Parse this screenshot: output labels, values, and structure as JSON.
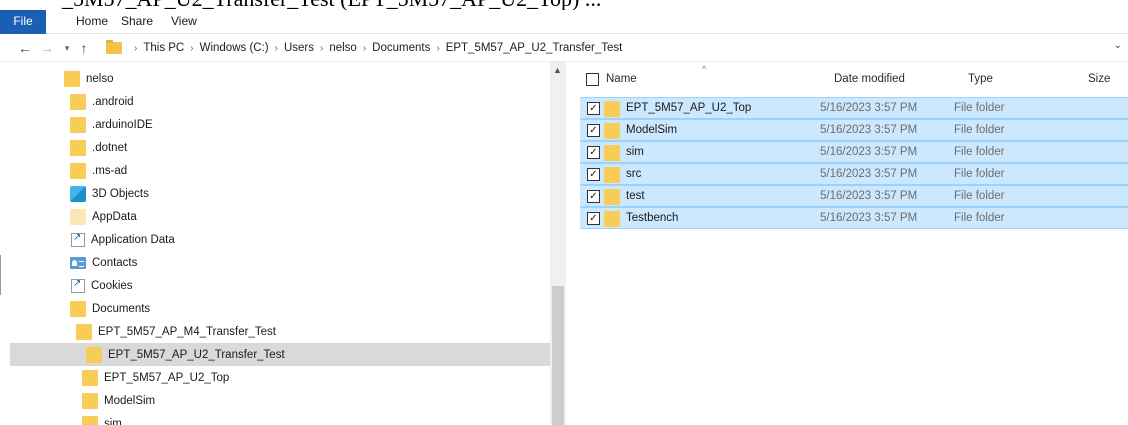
{
  "clipped_title": "_5M57_AP_U2_Transfer_Test (EPT_5M57_AP_U2_Top) ...",
  "ribbon": {
    "tabs": [
      "File",
      "Home",
      "Share",
      "View"
    ]
  },
  "address": {
    "breadcrumbs": [
      "This PC",
      "Windows (C:)",
      "Users",
      "nelso",
      "Documents",
      "EPT_5M57_AP_U2_Transfer_Test"
    ]
  },
  "nav": {
    "items": [
      {
        "label": "nelso",
        "icon": "folder-icon"
      },
      {
        "label": ".android",
        "icon": "folder-icon"
      },
      {
        "label": ".arduinoIDE",
        "icon": "folder-icon"
      },
      {
        "label": ".dotnet",
        "icon": "folder-icon"
      },
      {
        "label": ".ms-ad",
        "icon": "folder-icon"
      },
      {
        "label": "3D Objects",
        "icon": "3d-objects-icon"
      },
      {
        "label": "AppData",
        "icon": "folder-icon"
      },
      {
        "label": "Application Data",
        "icon": "shortcut-icon"
      },
      {
        "label": "Contacts",
        "icon": "contacts-icon"
      },
      {
        "label": "Cookies",
        "icon": "shortcut-icon"
      },
      {
        "label": "Documents",
        "icon": "folder-icon"
      },
      {
        "label": "EPT_5M57_AP_M4_Transfer_Test",
        "icon": "folder-icon"
      },
      {
        "label": "EPT_5M57_AP_U2_Transfer_Test",
        "icon": "folder-icon",
        "selected": true
      },
      {
        "label": "EPT_5M57_AP_U2_Top",
        "icon": "folder-icon"
      },
      {
        "label": "ModelSim",
        "icon": "folder-icon"
      },
      {
        "label": "sim",
        "icon": "folder-icon"
      }
    ]
  },
  "list": {
    "columns": {
      "name": "Name",
      "date": "Date modified",
      "type": "Type",
      "size": "Size"
    },
    "rows": [
      {
        "name": "EPT_5M57_AP_U2_Top",
        "date": "5/16/2023 3:57 PM",
        "type": "File folder",
        "checked": true
      },
      {
        "name": "ModelSim",
        "date": "5/16/2023 3:57 PM",
        "type": "File folder",
        "checked": true
      },
      {
        "name": "sim",
        "date": "5/16/2023 3:57 PM",
        "type": "File folder",
        "checked": true
      },
      {
        "name": "src",
        "date": "5/16/2023 3:57 PM",
        "type": "File folder",
        "checked": true
      },
      {
        "name": "test",
        "date": "5/16/2023 3:57 PM",
        "type": "File folder",
        "checked": true
      },
      {
        "name": "Testbench",
        "date": "5/16/2023 3:57 PM",
        "type": "File folder",
        "checked": true
      }
    ]
  },
  "colors": {
    "file_tab": "#1a5fb4",
    "selection": "#cce8ff",
    "selection_border": "#99d1ff",
    "nav_selected": "#d9d9d9",
    "folder": "#f8cd57"
  }
}
